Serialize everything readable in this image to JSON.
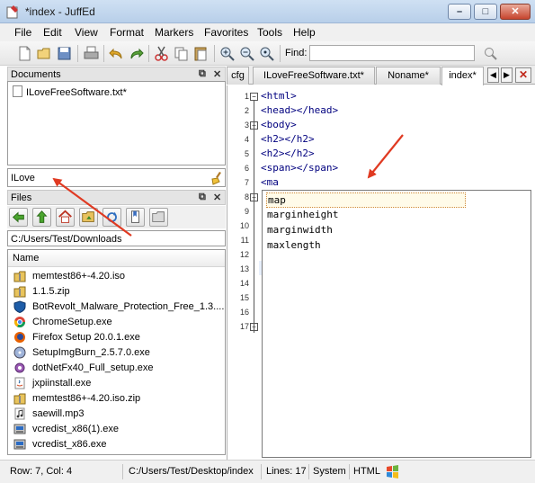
{
  "window": {
    "title": "*index - JuffEd"
  },
  "menu": [
    "File",
    "Edit",
    "View",
    "Format",
    "Markers",
    "Favorites",
    "Tools",
    "Help"
  ],
  "toolbar": {
    "find_label": "Find:",
    "find_value": ""
  },
  "documents_panel": {
    "title": "Documents",
    "items": [
      "ILoveFreeSoftware.txt*"
    ],
    "filter_value": "ILove"
  },
  "files_panel": {
    "title": "Files",
    "path": "C:/Users/Test/Downloads",
    "column_header": "Name",
    "files": [
      {
        "name": "memtest86+-4.20.iso",
        "icon": "folder-zip-icon"
      },
      {
        "name": "1.1.5.zip",
        "icon": "folder-zip-icon"
      },
      {
        "name": "BotRevolt_Malware_Protection_Free_1.3....",
        "icon": "shield-icon"
      },
      {
        "name": "ChromeSetup.exe",
        "icon": "chrome-icon"
      },
      {
        "name": "Firefox Setup 20.0.1.exe",
        "icon": "firefox-icon"
      },
      {
        "name": "SetupImgBurn_2.5.7.0.exe",
        "icon": "imgburn-icon"
      },
      {
        "name": "dotNetFx40_Full_setup.exe",
        "icon": "gear-installer-icon"
      },
      {
        "name": "jxpiinstall.exe",
        "icon": "java-icon"
      },
      {
        "name": "memtest86+-4.20.iso.zip",
        "icon": "folder-zip-icon"
      },
      {
        "name": "saewill.mp3",
        "icon": "audio-file-icon"
      },
      {
        "name": "vcredist_x86(1).exe",
        "icon": "installer-icon"
      },
      {
        "name": "vcredist_x86.exe",
        "icon": "installer-icon"
      }
    ]
  },
  "tabs": [
    {
      "label": "cfg"
    },
    {
      "label": "ILoveFreeSoftware.txt*"
    },
    {
      "label": "Noname*"
    },
    {
      "label": "index*"
    }
  ],
  "editor": {
    "lines": [
      {
        "n": "1",
        "text": "<html>"
      },
      {
        "n": "2",
        "text": "<head></head>"
      },
      {
        "n": "3",
        "text": "<body>"
      },
      {
        "n": "4",
        "text": "<h2></h2>"
      },
      {
        "n": "5",
        "text": "<h2></h2>"
      },
      {
        "n": "6",
        "text": "<span></span>"
      },
      {
        "n": "7",
        "text": "<ma"
      },
      {
        "n": "8",
        "text": ""
      },
      {
        "n": "9",
        "text": ""
      },
      {
        "n": "10",
        "text": ""
      },
      {
        "n": "11",
        "text": ""
      },
      {
        "n": "12",
        "text": ""
      },
      {
        "n": "13",
        "text": ""
      },
      {
        "n": "14",
        "text": ""
      },
      {
        "n": "15",
        "text": ""
      },
      {
        "n": "16",
        "text": ""
      },
      {
        "n": "17",
        "text": ""
      }
    ],
    "autocomplete": [
      "map",
      "marginheight",
      "marginwidth",
      "maxlength"
    ]
  },
  "status": {
    "position": "Row: 7, Col: 4",
    "path": "C:/Users/Test/Desktop/index",
    "lines": "Lines: 17",
    "eol": "System",
    "syntax": "HTML"
  },
  "colors": {
    "annotation_arrow": "#e03a22",
    "code_text": "#00007f"
  }
}
